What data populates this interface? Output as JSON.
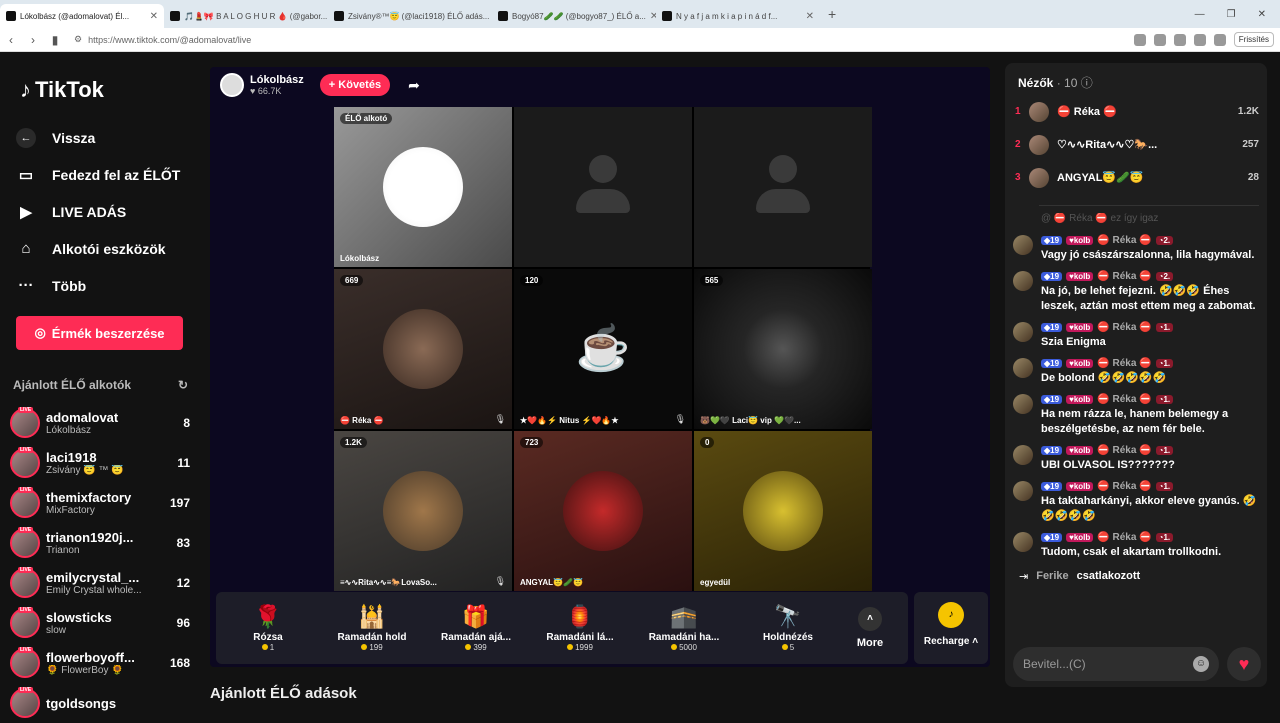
{
  "browser": {
    "tabs": [
      {
        "title": "Lókolbász (@adomalovat) Él...",
        "active": true
      },
      {
        "title": "🎵💄🎀 B A L O G H U R 🩸 (@gabor...",
        "active": false
      },
      {
        "title": "Zsivány®™😇 (@laci1918) ÉLŐ adás...",
        "active": false
      },
      {
        "title": "Bogyó87🥒🥒 (@bogyo87_) ÉLŐ a...",
        "active": false
      },
      {
        "title": "N y a f j a m k i a p i n á d f...",
        "active": false
      }
    ],
    "url": "https://www.tiktok.com/@adomalovat/live",
    "refresh_label": "Frissítés"
  },
  "sidebar": {
    "logo": "TikTok",
    "nav": [
      {
        "icon": "back-arrow-icon",
        "label": "Vissza"
      },
      {
        "icon": "tv-icon",
        "label": "Fedezd fel az ÉLŐT"
      },
      {
        "icon": "camera-icon",
        "label": "LIVE ADÁS"
      },
      {
        "icon": "creator-tools-icon",
        "label": "Alkotói eszközök"
      },
      {
        "icon": "more-dots-icon",
        "label": "Több"
      }
    ],
    "coins_button": "Érmék beszerzése",
    "recommended_title": "Ajánlott ÉLŐ alkotók",
    "live_badge": "LIVE",
    "recommended": [
      {
        "name": "adomalovat",
        "sub": "Lókolbász",
        "count": "8"
      },
      {
        "name": "laci1918",
        "sub": "Zsivány 😇 ™ 😇",
        "count": "11"
      },
      {
        "name": "themixfactory",
        "sub": "MixFactory",
        "count": "197"
      },
      {
        "name": "trianon1920j...",
        "sub": "Trianon",
        "count": "83"
      },
      {
        "name": "emilycrystal_...",
        "sub": "Emily Crystal whole...",
        "count": "12"
      },
      {
        "name": "slowsticks",
        "sub": "slow",
        "count": "96"
      },
      {
        "name": "flowerboyoff...",
        "sub": "🌻 FlowerBoy 🌻",
        "count": "168"
      },
      {
        "name": "tgoldsongs",
        "sub": "",
        "count": ""
      }
    ]
  },
  "host": {
    "name": "Lókolbász",
    "likes": "66.7K",
    "follow_label": "+ Követés"
  },
  "grid": [
    {
      "badge": "ÉLŐ alkotó",
      "name": "Lókolbász",
      "type": "host",
      "muted": false
    },
    {
      "badge": "",
      "name": "",
      "type": "empty",
      "muted": false
    },
    {
      "badge": "",
      "name": "",
      "type": "empty",
      "muted": false
    },
    {
      "badge": "669",
      "name": "⛔ Réka ⛔",
      "type": "woman",
      "muted": true
    },
    {
      "badge": "120",
      "name": "★❤️🔥⚡ Nitus ⚡❤️🔥★",
      "type": "coffee",
      "muted": true
    },
    {
      "badge": "565",
      "name": "🐻💚🖤 Laci😇 vip 💚🖤...",
      "type": "dark",
      "muted": false
    },
    {
      "badge": "1.2K",
      "name": "≡∿∿Rita∿∿≡🐎LovaSo...",
      "type": "horse",
      "muted": true
    },
    {
      "badge": "723",
      "name": "ANGYAL😇🥒😇",
      "type": "angel",
      "muted": false
    },
    {
      "badge": "0",
      "name": "egyedül",
      "type": "smiley",
      "muted": false
    }
  ],
  "gifts": [
    {
      "icon": "🌹",
      "name": "Rózsa",
      "price": "1"
    },
    {
      "icon": "🕌",
      "name": "Ramadán hold",
      "price": "199"
    },
    {
      "icon": "🎁",
      "name": "Ramadán ajá...",
      "price": "399"
    },
    {
      "icon": "🏮",
      "name": "Ramadáni lá...",
      "price": "1999"
    },
    {
      "icon": "🕋",
      "name": "Ramadáni ha...",
      "price": "5000"
    },
    {
      "icon": "🔭",
      "name": "Holdnézés",
      "price": "5"
    }
  ],
  "more_label": "More",
  "recharge_label": "Recharge",
  "bottom_title": "Ajánlott ÉLŐ adások",
  "chat": {
    "viewers_title": "Nézők",
    "viewers_count": "· 10",
    "viewers": [
      {
        "rank": "1",
        "name": "⛔ Réka ⛔",
        "score": "1.2K"
      },
      {
        "rank": "2",
        "name": "♡∿∿Rita∿∿♡🐎...",
        "score": "257"
      },
      {
        "rank": "3",
        "name": "ANGYAL😇🥒😇",
        "score": "28"
      }
    ],
    "faded": "@ ⛔ Réka ⛔ ez így igaz",
    "messages": [
      {
        "level": "19",
        "fan": "kolb",
        "name": "⛔ Réka ⛔",
        "rank": "2.",
        "text": "Vagy jó császárszalonna, lila hagymával."
      },
      {
        "level": "19",
        "fan": "kolb",
        "name": "⛔ Réka ⛔",
        "rank": "2.",
        "text": "Na jó, be lehet fejezni. 🤣🤣🤣 Éhes leszek, aztán most ettem meg a zabomat."
      },
      {
        "level": "19",
        "fan": "kolb",
        "name": "⛔ Réka ⛔",
        "rank": "1.",
        "text": "Szia Enigma"
      },
      {
        "level": "19",
        "fan": "kolb",
        "name": "⛔ Réka ⛔",
        "rank": "1.",
        "text": "De bolond 🤣🤣🤣🤣🤣"
      },
      {
        "level": "19",
        "fan": "kolb",
        "name": "⛔ Réka ⛔",
        "rank": "1.",
        "text": "Ha nem rázza le, hanem belemegy a beszélgetésbe, az nem fér bele."
      },
      {
        "level": "19",
        "fan": "kolb",
        "name": "⛔ Réka ⛔",
        "rank": "1.",
        "text": "UBI OLVASOL IS???????"
      },
      {
        "level": "19",
        "fan": "kolb",
        "name": "⛔ Réka ⛔",
        "rank": "1.",
        "text": "Ha taktaharkányi, akkor eleve gyanús. 🤣🤣🤣🤣🤣"
      },
      {
        "level": "19",
        "fan": "kolb",
        "name": "⛔ Réka ⛔",
        "rank": "1.",
        "text": "Tudom, csak el akartam trollkodni."
      }
    ],
    "joined_name": "Ferike",
    "joined_text": "csatlakozott",
    "input_placeholder": "Bevitel...(C)"
  }
}
